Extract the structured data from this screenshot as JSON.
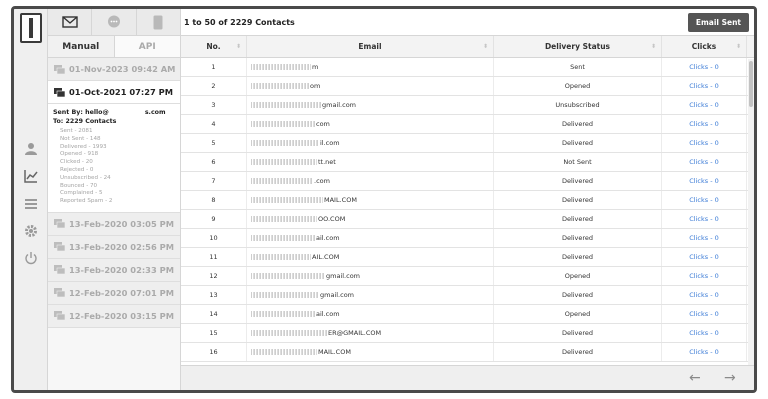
{
  "toolbar": {
    "record_count": "1 to 50 of 2229 Contacts",
    "email_sent_label": "Email Sent"
  },
  "tabs": [
    {
      "label": "Manual",
      "active": true
    },
    {
      "label": "API",
      "active": false
    }
  ],
  "channels": [
    "email-icon",
    "sms-icon",
    "mobile-icon"
  ],
  "rail_icons": [
    "user-icon",
    "chart-icon",
    "list-icon",
    "gear-icon",
    "power-icon"
  ],
  "campaigns": [
    {
      "date": "01-Nov-2023 09:42 AM",
      "active": false
    },
    {
      "date": "01-Oct-2021 07:27 PM",
      "active": true
    },
    {
      "date": "13-Feb-2020 03:05 PM",
      "active": false
    },
    {
      "date": "13-Feb-2020 02:56 PM",
      "active": false
    },
    {
      "date": "13-Feb-2020 02:33 PM",
      "active": false
    },
    {
      "date": "12-Feb-2020 07:01 PM",
      "active": false
    },
    {
      "date": "12-Feb-2020 03:15 PM",
      "active": false
    }
  ],
  "detail": {
    "sent_by_prefix": "Sent By: hello@",
    "sent_by_suffix": "s.com",
    "to": "To: 2229 Contacts",
    "stats": [
      "Sent - 2081",
      "Not Sent - 148",
      "Delivered - 1993",
      "Opened - 918",
      "Clicked - 20",
      "Rejected - 0",
      "Unsubscribed - 24",
      "Bounced - 70",
      "Complained - 5",
      "Reported Spam - 2"
    ]
  },
  "columns": [
    "No.",
    "Email",
    "Delivery Status",
    "Clicks"
  ],
  "rows": [
    {
      "no": "1",
      "email_visible": "m",
      "status": "Sent",
      "clicks": "Clicks - 0"
    },
    {
      "no": "2",
      "email_visible": "om",
      "status": "Opened",
      "clicks": "Clicks - 0"
    },
    {
      "no": "3",
      "email_visible": "gmail.com",
      "status": "Unsubscribed",
      "clicks": "Clicks - 0"
    },
    {
      "no": "4",
      "email_visible": "com",
      "status": "Delivered",
      "clicks": "Clicks - 0"
    },
    {
      "no": "5",
      "email_visible": "il.com",
      "status": "Delivered",
      "clicks": "Clicks - 0"
    },
    {
      "no": "6",
      "email_visible": "tt.net",
      "status": "Not Sent",
      "clicks": "Clicks - 0"
    },
    {
      "no": "7",
      "email_visible": ".com",
      "status": "Delivered",
      "clicks": "Clicks - 0"
    },
    {
      "no": "8",
      "email_visible": "MAIL.COM",
      "status": "Delivered",
      "clicks": "Clicks - 0"
    },
    {
      "no": "9",
      "email_visible": "OO.COM",
      "status": "Delivered",
      "clicks": "Clicks - 0"
    },
    {
      "no": "10",
      "email_visible": "ail.com",
      "status": "Delivered",
      "clicks": "Clicks - 0"
    },
    {
      "no": "11",
      "email_visible": "AIL.COM",
      "status": "Delivered",
      "clicks": "Clicks - 0"
    },
    {
      "no": "12",
      "email_visible": "gmail.com",
      "status": "Opened",
      "clicks": "Clicks - 0"
    },
    {
      "no": "13",
      "email_visible": "gmail.com",
      "status": "Delivered",
      "clicks": "Clicks - 0"
    },
    {
      "no": "14",
      "email_visible": "ail.com",
      "status": "Opened",
      "clicks": "Clicks - 0"
    },
    {
      "no": "15",
      "email_visible": "ER@GMAIL.COM",
      "status": "Delivered",
      "clicks": "Clicks - 0"
    },
    {
      "no": "16",
      "email_visible": "MAIL.COM",
      "status": "Delivered",
      "clicks": "Clicks - 0"
    }
  ],
  "pager": {
    "prev_icon": "arrow-left-icon",
    "next_icon": "arrow-right-icon"
  },
  "colors": {
    "link": "#3b7bd6",
    "button": "#555555",
    "frame": "#4a4a4a"
  }
}
